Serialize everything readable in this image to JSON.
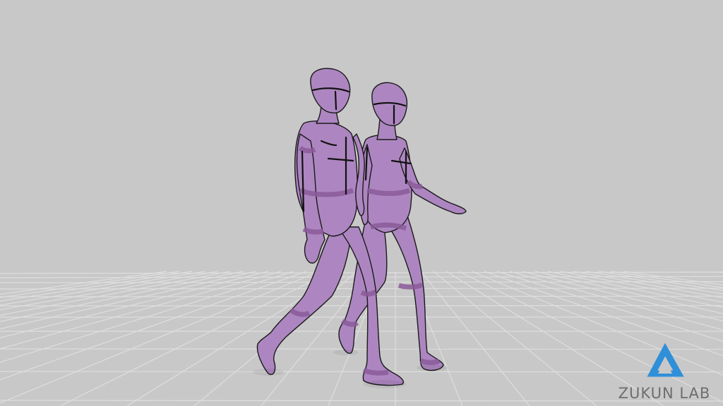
{
  "scene": {
    "description_type": "3d-mannequin-viewport",
    "colors": {
      "background": "#c8c8c8",
      "grid_line": "#dedede",
      "mannequin_fill": "#ad86c1",
      "mannequin_shade": "#8e5e9d",
      "mannequin_outline": "#1a1a1a",
      "logo_blue": "#2f8fd8",
      "logo_text": "#6e6e6e"
    }
  },
  "logo": {
    "icon": "triangle-logo-icon",
    "text": "ZUKUN LAB"
  }
}
